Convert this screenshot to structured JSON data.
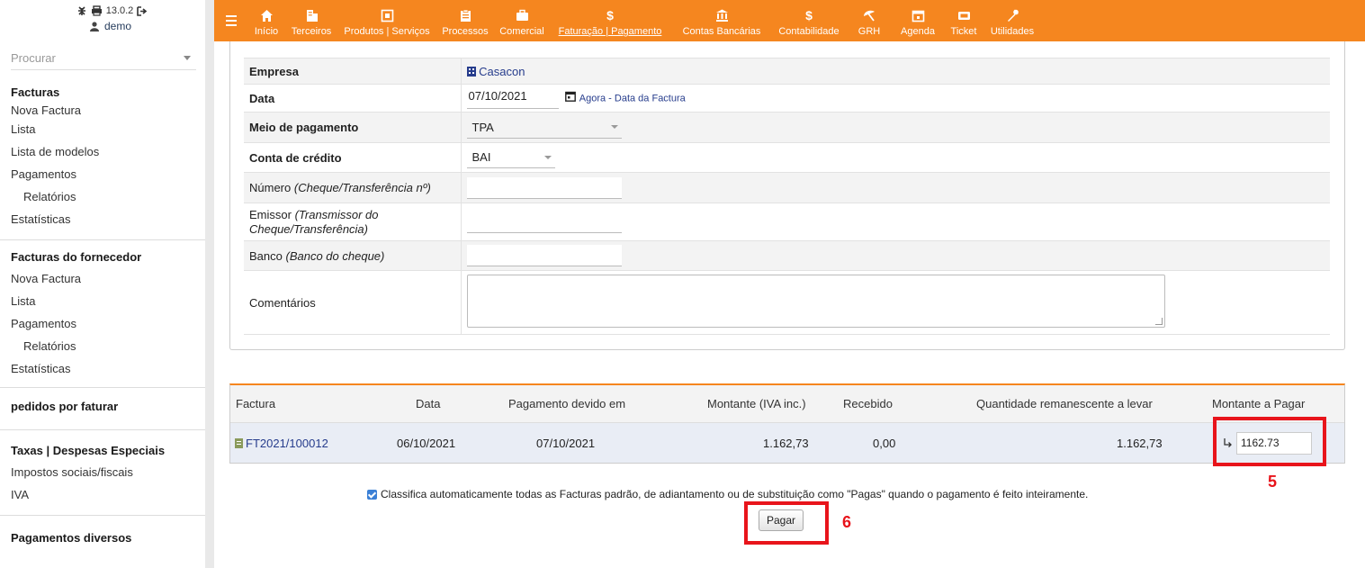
{
  "app": {
    "version": "13.0.2",
    "user": "demo"
  },
  "sidebar": {
    "search_placeholder": "Procurar",
    "sections": [
      {
        "title": "Facturas",
        "items": [
          "Nova Factura",
          "Lista",
          "Lista de modelos",
          "Pagamentos",
          "Relatórios",
          "Estatísticas"
        ]
      },
      {
        "title": "Facturas do fornecedor",
        "items": [
          "Nova Factura",
          "Lista",
          "Pagamentos",
          "Relatórios",
          "Estatísticas"
        ]
      },
      {
        "title": "pedidos por faturar"
      },
      {
        "title": "Taxas | Despesas Especiais",
        "items": [
          "Impostos sociais/fiscais",
          "IVA"
        ]
      },
      {
        "title": "Pagamentos diversos"
      }
    ]
  },
  "nav": {
    "items": [
      {
        "label": "Início",
        "icon": "home-icon"
      },
      {
        "label": "Terceiros",
        "icon": "building-icon"
      },
      {
        "label": "Produtos | Serviços",
        "icon": "cube-icon"
      },
      {
        "label": "Processos",
        "icon": "clipboard-icon"
      },
      {
        "label": "Comercial",
        "icon": "briefcase-icon"
      },
      {
        "label": "Faturação | Pagamento",
        "icon": "dollar-icon",
        "active": true
      },
      {
        "label": "Contas Bancárias",
        "icon": "bank-icon"
      },
      {
        "label": "Contabilidade",
        "icon": "dollar-icon"
      },
      {
        "label": "GRH",
        "icon": "umbrella-icon"
      },
      {
        "label": "Agenda",
        "icon": "calendar-icon"
      },
      {
        "label": "Ticket",
        "icon": "ticket-icon"
      },
      {
        "label": "Utilidades",
        "icon": "wrench-icon"
      }
    ]
  },
  "form": {
    "empresa_label": "Empresa",
    "empresa_value": "Casacon",
    "data_label": "Data",
    "data_value": "07/10/2021",
    "data_link_now": "Agora",
    "data_link_sep": " - ",
    "data_link_invoice": "Data da Factura",
    "meio_label": "Meio de pagamento",
    "meio_value": "TPA",
    "conta_label": "Conta de crédito",
    "conta_value": "BAI",
    "numero_label": "Número",
    "numero_hint": "(Cheque/Transferência nº)",
    "emissor_label": "Emissor",
    "emissor_hint": "(Transmissor do Cheque/Transferência)",
    "banco_label": "Banco",
    "banco_hint": "(Banco do cheque)",
    "comentarios_label": "Comentários"
  },
  "payments": {
    "headers": [
      "Factura",
      "Data",
      "Pagamento devido em",
      "Montante (IVA inc.)",
      "Recebido",
      "Quantidade remanescente a levar",
      "Montante a Pagar"
    ],
    "rows": [
      {
        "ref": "FT2021/100012",
        "date": "06/10/2021",
        "due": "07/10/2021",
        "amount": "1.162,73",
        "received": "0,00",
        "remaining": "1.162,73",
        "to_pay": "1162.73"
      }
    ]
  },
  "auto_classify_text": "Classifica automaticamente todas as Facturas padrão, de adiantamento ou de substituição como \"Pagas\" quando o pagamento é feito inteiramente.",
  "pay_button_label": "Pagar",
  "annotations": {
    "step5": "5",
    "step6": "6"
  },
  "colors": {
    "nav_bg": "#f5861f",
    "annotation": "#e8141b",
    "link": "#263c8c"
  }
}
